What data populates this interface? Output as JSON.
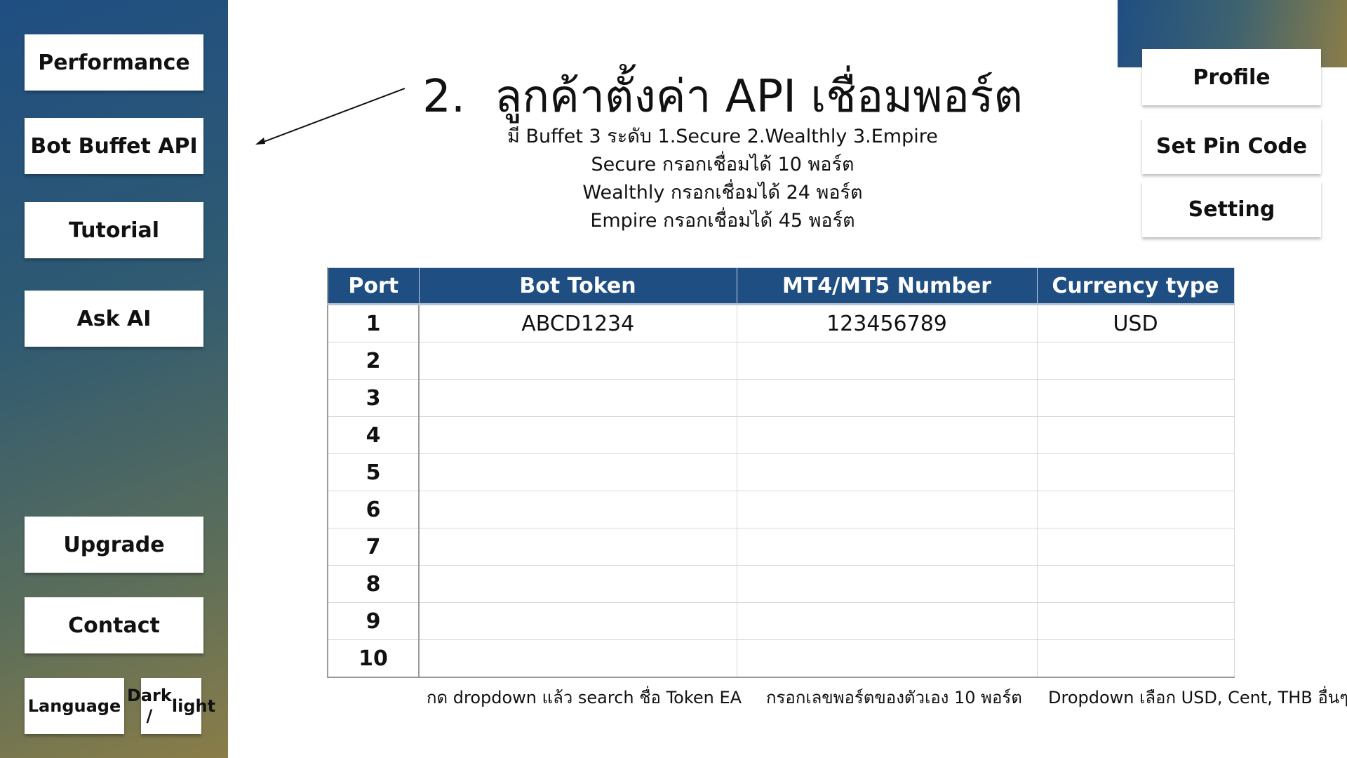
{
  "sidebar": {
    "items": [
      {
        "label": "Performance"
      },
      {
        "label": "Bot Buffet API"
      },
      {
        "label": "Tutorial"
      },
      {
        "label": "Ask AI"
      },
      {
        "label": "Upgrade"
      },
      {
        "label": "Contact"
      }
    ],
    "language_label": "Language",
    "theme_label_line1": "Dark /",
    "theme_label_line2": "light"
  },
  "top_menu": {
    "profile_label": "Profile",
    "pin_label": "Set Pin Code",
    "setting_label": "Setting"
  },
  "heading": {
    "number": "2.",
    "title": "ลูกค้าตั้งค่า API เชื่อมพอร์ต"
  },
  "info_lines": [
    "มี Buffet 3 ระดับ 1.Secure  2.Wealthly  3.Empire",
    "Secure กรอกเชื่อมได้ 10 พอร์ต",
    "Wealthly กรอกเชื่อมได้ 24 พอร์ต",
    "Empire กรอกเชื่อมได้ 45 พอร์ต"
  ],
  "table": {
    "headers": [
      "Port",
      "Bot Token",
      "MT4/MT5 Number",
      "Currency type"
    ],
    "rows": [
      [
        "1",
        "ABCD1234",
        "123456789",
        "USD"
      ],
      [
        "2",
        "",
        "",
        ""
      ],
      [
        "3",
        "",
        "",
        ""
      ],
      [
        "4",
        "",
        "",
        ""
      ],
      [
        "5",
        "",
        "",
        ""
      ],
      [
        "6",
        "",
        "",
        ""
      ],
      [
        "7",
        "",
        "",
        ""
      ],
      [
        "8",
        "",
        "",
        ""
      ],
      [
        "9",
        "",
        "",
        ""
      ],
      [
        "10",
        "",
        "",
        ""
      ]
    ]
  },
  "notes": {
    "token": "กด dropdown แล้ว search ชื่อ Token EA",
    "mt": "กรอกเลขพอร์ตของตัวเอง 10 พอร์ต",
    "currency": "Dropdown เลือก USD, Cent, THB อื่นๆ"
  }
}
